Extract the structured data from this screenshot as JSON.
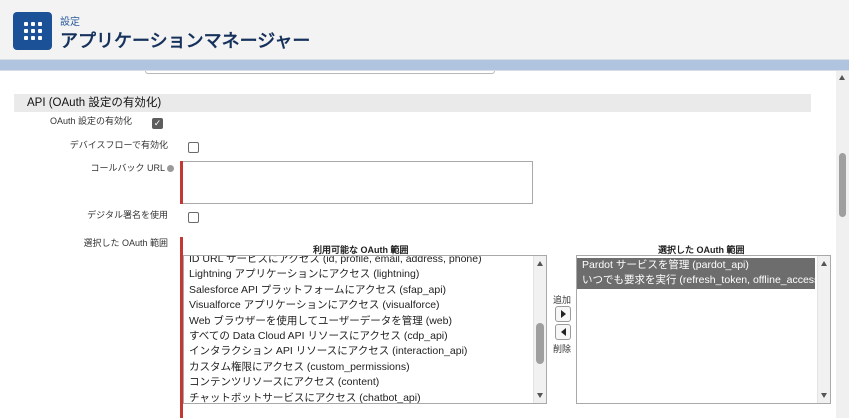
{
  "header": {
    "breadcrumb": "設定",
    "title": "アプリケーションマネージャー",
    "icon": "app-launcher-grid-icon"
  },
  "oauth": {
    "section_title": "API (OAuth 設定の有効化)",
    "enable_oauth_label": "OAuth 設定の有効化",
    "enable_oauth_checked": true,
    "device_flow_label": "デバイスフローで有効化",
    "device_flow_checked": false,
    "callback_url_label": "コールバック URL",
    "callback_url_value": "",
    "digital_signature_label": "デジタル署名を使用",
    "digital_signature_checked": false,
    "selected_scopes_label": "選択した OAuth 範囲",
    "available_header": "利用可能な OAuth 範囲",
    "selected_header": "選択した OAuth 範囲",
    "add_label": "追加",
    "remove_label": "削除",
    "available_scopes": [
      "ID URL サービスにアクセス (id, profile, email, address, phone)",
      "Lightning アプリケーションにアクセス (lightning)",
      "Salesforce API プラットフォームにアクセス (sfap_api)",
      "Visualforce アプリケーションにアクセス (visualforce)",
      "Web ブラウザーを使用してユーザーデータを管理 (web)",
      "すべての Data Cloud API リソースにアクセス (cdp_api)",
      "インタラクション API リソースにアクセス (interaction_api)",
      "カスタム権限にアクセス (custom_permissions)",
      "コンテンツリソースにアクセス (content)",
      "チャットボットサービスにアクセス (chatbot_api)"
    ],
    "selected_scopes": [
      "Pardot サービスを管理 (pardot_api)",
      "いつでも要求を実行 (refresh_token, offline_access)"
    ]
  },
  "colors": {
    "brand": "#1b5297",
    "required": "#c23934",
    "selected_item": "#6d6d6d"
  }
}
